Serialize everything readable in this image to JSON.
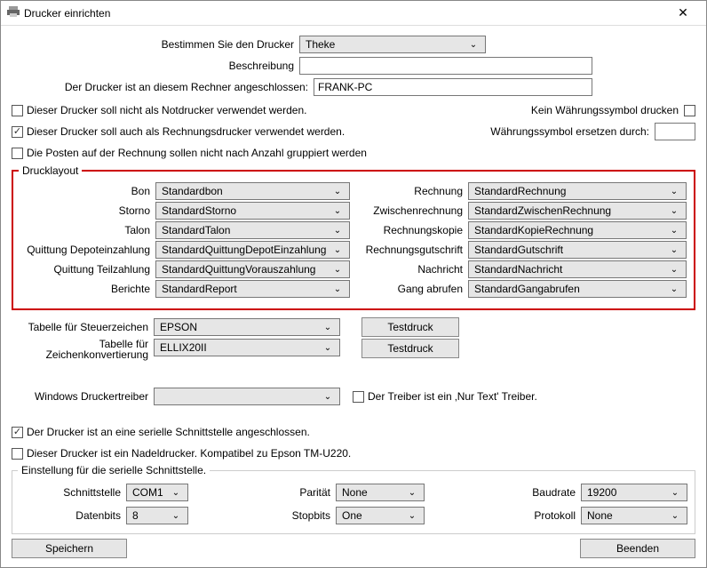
{
  "window": {
    "title": "Drucker einrichten"
  },
  "top": {
    "choose_label": "Bestimmen Sie den Drucker",
    "choose_value": "Theke",
    "desc_label": "Beschreibung",
    "desc_value": "",
    "host_label": "Der Drucker ist an diesem Rechner angeschlossen:",
    "host_value": "FRANK-PC"
  },
  "checks": {
    "not_emergency": "Dieser Drucker soll nicht als Notdrucker verwendet werden.",
    "also_invoice": "Dieser Drucker soll auch als Rechnungsdrucker verwendet werden.",
    "no_group": "Die Posten auf der Rechnung sollen nicht nach Anzahl gruppiert werden"
  },
  "currency": {
    "no_symbol": "Kein Währungssymbol drucken",
    "replace_label": "Währungssymbol ersetzen durch:",
    "replace_value": ""
  },
  "layout": {
    "legend": "Drucklayout",
    "left": [
      {
        "label": "Bon",
        "value": "Standardbon"
      },
      {
        "label": "Storno",
        "value": "StandardStorno"
      },
      {
        "label": "Talon",
        "value": "StandardTalon"
      },
      {
        "label": "Quittung Depoteinzahlung",
        "value": "StandardQuittungDepotEinzahlung"
      },
      {
        "label": "Quittung Teilzahlung",
        "value": "StandardQuittungVorauszahlung"
      },
      {
        "label": "Berichte",
        "value": "StandardReport"
      }
    ],
    "right": [
      {
        "label": "Rechnung",
        "value": "StandardRechnung"
      },
      {
        "label": "Zwischenrechnung",
        "value": "StandardZwischenRechnung"
      },
      {
        "label": "Rechnungskopie",
        "value": "StandardKopieRechnung"
      },
      {
        "label": "Rechnungsgutschrift",
        "value": "StandardGutschrift"
      },
      {
        "label": "Nachricht",
        "value": "StandardNachricht"
      },
      {
        "label": "Gang abrufen",
        "value": "StandardGangabrufen"
      }
    ]
  },
  "tables": {
    "tax_label": "Tabelle für Steuerzeichen",
    "tax_value": "EPSON",
    "conv_label": "Tabelle für\nZeichenkonvertierung",
    "conv_value": "ELLIX20II",
    "testdruck": "Testdruck"
  },
  "driver": {
    "label": "Windows Druckertreiber",
    "value": "",
    "text_only": "Der Treiber ist ein ‚Nur Text' Treiber."
  },
  "serial": {
    "check_serial": "Der Drucker ist an eine serielle Schnittstelle angeschlossen.",
    "check_needle": "Dieser Drucker ist ein Nadeldrucker. Kompatibel zu Epson TM-U220.",
    "legend": "Einstellung für die serielle Schnittstelle.",
    "port_label": "Schnittstelle",
    "port_value": "COM1",
    "bits_label": "Datenbits",
    "bits_value": "8",
    "parity_label": "Parität",
    "parity_value": "None",
    "stop_label": "Stopbits",
    "stop_value": "One",
    "baud_label": "Baudrate",
    "baud_value": "19200",
    "proto_label": "Protokoll",
    "proto_value": "None"
  },
  "footer": {
    "save": "Speichern",
    "close": "Beenden"
  }
}
